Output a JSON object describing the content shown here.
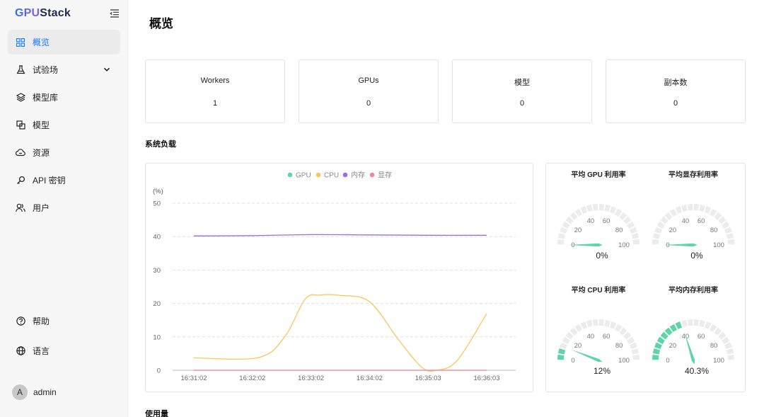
{
  "app": {
    "logo_prefix": "GPU",
    "logo_suffix": "Stack"
  },
  "sidebar": {
    "items": [
      {
        "label": "概览",
        "icon": "dashboard-grid-icon",
        "active": true
      },
      {
        "label": "试验场",
        "icon": "flask-icon",
        "expandable": true
      },
      {
        "label": "模型库",
        "icon": "layers-icon"
      },
      {
        "label": "模型",
        "icon": "model-copy-icon"
      },
      {
        "label": "资源",
        "icon": "cloud-resource-icon"
      },
      {
        "label": "API 密钥",
        "icon": "key-icon"
      },
      {
        "label": "用户",
        "icon": "users-icon"
      }
    ],
    "bottom": [
      {
        "label": "帮助",
        "icon": "help-circle-icon"
      },
      {
        "label": "语言",
        "icon": "globe-icon"
      }
    ],
    "user": {
      "avatar_letter": "A",
      "name": "admin"
    }
  },
  "page": {
    "title": "概览"
  },
  "stats": [
    {
      "label": "Workers",
      "value": "1"
    },
    {
      "label": "GPUs",
      "value": "0"
    },
    {
      "label": "模型",
      "value": "0"
    },
    {
      "label": "副本数",
      "value": "0"
    }
  ],
  "sections": {
    "system_load": "系统负载",
    "usage": "使用量"
  },
  "chart_data": [
    {
      "type": "line",
      "ylabel": "(%)",
      "ylim": [
        0,
        50
      ],
      "yticks": [
        0,
        10,
        20,
        30,
        40,
        50
      ],
      "x": [
        "16:31:02",
        "16:32:02",
        "16:33:02",
        "16:34:02",
        "16:35:03",
        "16:36:03"
      ],
      "grid": true,
      "legend_position": "top-center",
      "series": [
        {
          "name": "GPU",
          "color": "#5fd4a8",
          "points": [
            [
              0,
              0
            ],
            [
              1,
              0
            ],
            [
              2,
              0
            ],
            [
              3,
              0
            ],
            [
              4,
              0
            ],
            [
              5,
              0
            ]
          ]
        },
        {
          "name": "CPU",
          "color": "#f7c75b",
          "points": [
            [
              0,
              3.7
            ],
            [
              1.1,
              3.8
            ],
            [
              1.55,
              10
            ],
            [
              1.9,
              21.3
            ],
            [
              2.15,
              22.5
            ],
            [
              2.5,
              22.4
            ],
            [
              3.0,
              20.5
            ],
            [
              3.5,
              9
            ],
            [
              3.9,
              0.8
            ],
            [
              4.15,
              0
            ],
            [
              4.5,
              3
            ],
            [
              5,
              17
            ]
          ]
        },
        {
          "name": "内存",
          "color": "#9a6ee0",
          "points": [
            [
              0,
              40.2
            ],
            [
              1,
              40.3
            ],
            [
              2,
              40.6
            ],
            [
              3,
              40.5
            ],
            [
              4,
              40.4
            ],
            [
              5,
              40.4
            ]
          ]
        },
        {
          "name": "显存",
          "color": "#ef86a4",
          "points": [
            [
              0,
              0
            ],
            [
              1,
              0
            ],
            [
              2,
              0
            ],
            [
              3,
              0
            ],
            [
              4,
              0
            ],
            [
              5,
              0
            ]
          ]
        }
      ]
    },
    {
      "type": "gauge",
      "gauges": [
        {
          "title": "平均 GPU 利用率",
          "value": 0,
          "display": "0%",
          "color": "#5fd4a8"
        },
        {
          "title": "平均显存利用率",
          "value": 0,
          "display": "0%",
          "color": "#5fd4a8"
        },
        {
          "title": "平均 CPU 利用率",
          "value": 12,
          "display": "12%",
          "color": "#5fd4a8"
        },
        {
          "title": "平均内存利用率",
          "value": 40.3,
          "display": "40.3%",
          "color": "#5fd4a8"
        }
      ],
      "range": [
        0,
        100
      ],
      "ticks": [
        "0",
        "20",
        "40",
        "60",
        "80",
        "100"
      ]
    }
  ]
}
